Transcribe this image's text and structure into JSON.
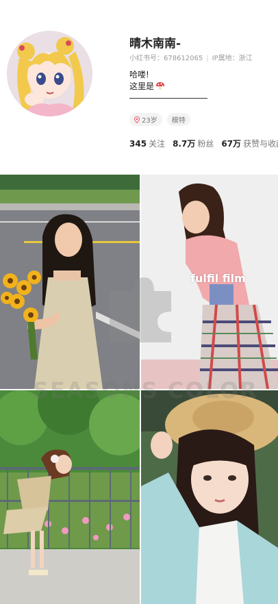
{
  "profile": {
    "name": "晴木南南-",
    "account_id": "小红书号：678612065",
    "ip_location": "IP属地：浙江",
    "bio_line1": "哈喽!",
    "bio_line2": "这里是",
    "avatar_icon": "cartoon-avatar-icon"
  },
  "tags": [
    {
      "label": "23岁",
      "icon": "location-pin-icon"
    },
    {
      "label": "模特"
    }
  ],
  "stats": [
    {
      "value": "345",
      "label": "关注"
    },
    {
      "value": "8.7万",
      "label": "粉丝"
    },
    {
      "value": "67万",
      "label": "获赞与收藏"
    }
  ],
  "photos": {
    "film_label": "fulfil film",
    "watermark": "SEASONS COLOR"
  },
  "colors": {
    "accent": "#f25a6b",
    "muted_text": "#9a9a9a",
    "tag_bg": "#f3f3f3"
  }
}
